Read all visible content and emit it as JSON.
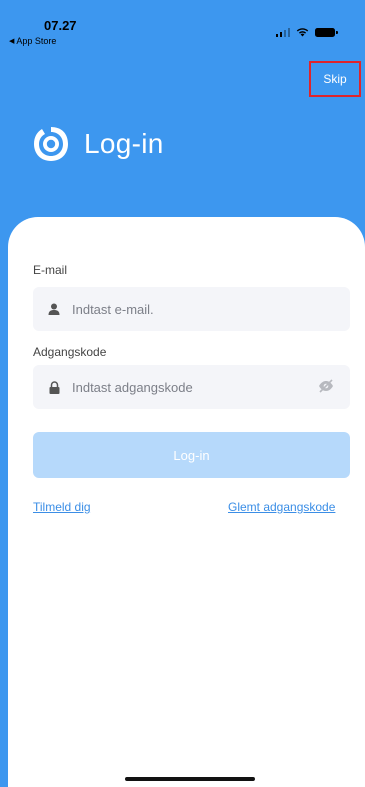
{
  "status_bar": {
    "time": "07.27",
    "back_label": "App Store"
  },
  "header": {
    "skip_label": "Skip",
    "title": "Log-in",
    "logo_icon": "eye-ring-logo"
  },
  "form": {
    "email_label": "E-mail",
    "email_placeholder": "Indtast e-mail.",
    "password_label": "Adgangskode",
    "password_placeholder": "Indtast adgangskode",
    "login_label": "Log-in"
  },
  "links": {
    "signup": "Tilmeld dig",
    "forgot": "Glemt adgangskode"
  },
  "colors": {
    "brand_blue": "#3d97ef",
    "skip_highlight": "#e0242b",
    "button_disabled": "#b6d9fb",
    "link": "#3b8ee6"
  }
}
